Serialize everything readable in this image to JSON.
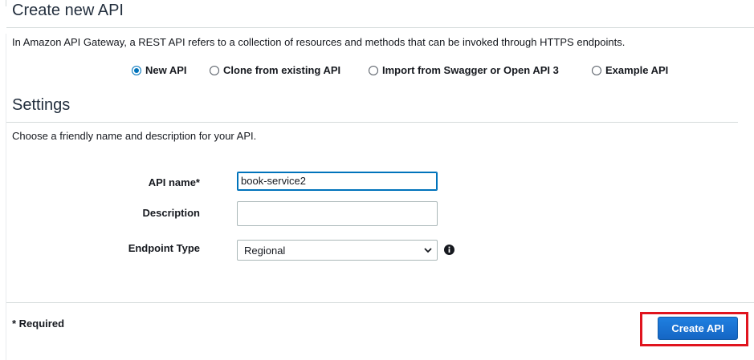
{
  "header": {
    "title": "Create new API"
  },
  "intro": {
    "text": "In Amazon API Gateway, a REST API refers to a collection of resources and methods that can be invoked through HTTPS endpoints."
  },
  "api_type": {
    "options": [
      {
        "label": "New API",
        "selected": true
      },
      {
        "label": "Clone from existing API",
        "selected": false
      },
      {
        "label": "Import from Swagger or Open API 3",
        "selected": false
      },
      {
        "label": "Example API",
        "selected": false
      }
    ]
  },
  "settings": {
    "title": "Settings",
    "description": "Choose a friendly name and description for your API.",
    "api_name": {
      "label": "API name*",
      "value": "book-service2"
    },
    "description_field": {
      "label": "Description",
      "value": ""
    },
    "endpoint_type": {
      "label": "Endpoint Type",
      "selected": "Regional"
    }
  },
  "footer": {
    "required_note": "* Required",
    "create_label": "Create API"
  },
  "colors": {
    "accent": "#0073bb",
    "primary_button": "#1a73e8",
    "highlight_box": "#e0141e"
  },
  "icons": {
    "endpoint_info": "info-icon",
    "select_chevron": "chevron-down-icon"
  }
}
